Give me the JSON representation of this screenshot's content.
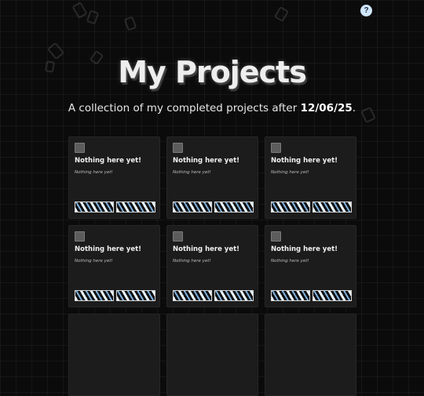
{
  "help": {
    "label": "?"
  },
  "header": {
    "title": "My Projects",
    "subtitle_prefix": "A collection of my completed projects after ",
    "subtitle_date": "12/06/25",
    "subtitle_suffix": "."
  },
  "projects": [
    {
      "title": "Nothing here yet!",
      "description": "Nothing here yet!"
    },
    {
      "title": "Nothing here yet!",
      "description": "Nothing here yet!"
    },
    {
      "title": "Nothing here yet!",
      "description": "Nothing here yet!"
    },
    {
      "title": "Nothing here yet!",
      "description": "Nothing here yet!"
    },
    {
      "title": "Nothing here yet!",
      "description": "Nothing here yet!"
    },
    {
      "title": "Nothing here yet!",
      "description": "Nothing here yet!"
    },
    {
      "title": "",
      "description": ""
    },
    {
      "title": "",
      "description": ""
    },
    {
      "title": "",
      "description": ""
    }
  ],
  "colors": {
    "background": "#0b0b0b",
    "card": "#1c1c1c",
    "help_badge": "#cfe6fb"
  },
  "icons": {
    "card_placeholder": "image-placeholder-icon",
    "tag": "tech-tag-icon"
  }
}
